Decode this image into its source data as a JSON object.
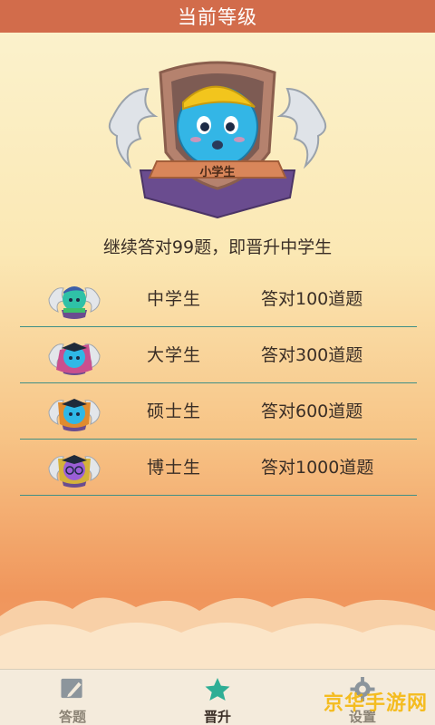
{
  "header": {
    "title": "当前等级"
  },
  "current_level": {
    "badge_label": "小学生"
  },
  "progress_text": "继续答对99题，即晋升中学生",
  "levels": [
    {
      "name": "中学生",
      "requirement": "答对100道题"
    },
    {
      "name": "大学生",
      "requirement": "答对300道题"
    },
    {
      "name": "硕士生",
      "requirement": "答对600道题"
    },
    {
      "name": "博士生",
      "requirement": "答对1000道题"
    }
  ],
  "tabs": [
    {
      "label": "答题",
      "icon": "pencil-icon",
      "active": false
    },
    {
      "label": "晋升",
      "icon": "star-icon",
      "active": true
    },
    {
      "label": "设置",
      "icon": "gear-icon",
      "active": false
    }
  ],
  "watermark": "京华手游网",
  "colors": {
    "header_bg": "#d26c4b",
    "accent_teal": "#2fae95",
    "divider": "#3f8f86",
    "badge_ribbon": "#d9865a",
    "badge_purple": "#6a4c8f"
  }
}
